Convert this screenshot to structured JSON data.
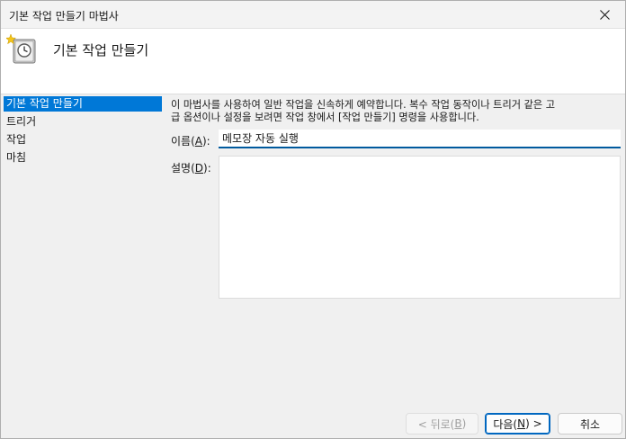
{
  "window": {
    "title": "기본 작업 만들기 마법사"
  },
  "header": {
    "title": "기본 작업 만들기",
    "icon": "task-scheduler-clock-icon"
  },
  "nav": {
    "items": [
      {
        "label": "기본 작업 만들기",
        "active": true
      },
      {
        "label": "트리거",
        "active": false
      },
      {
        "label": "작업",
        "active": false
      },
      {
        "label": "마침",
        "active": false
      }
    ]
  },
  "main": {
    "description_line1": "이 마법사를 사용하여 일반 작업을 신속하게 예약합니다. 복수 작업 동작이나 트리거 같은 고",
    "description_line2": "급 옵션이나 설정을 보려면 작업 창에서 [작업 만들기] 명령을 사용합니다.",
    "name_label": "이름",
    "name_accel": "A",
    "name_value": "메모장 자동 실행",
    "desc_label": "설명",
    "desc_accel": "D",
    "desc_value": ""
  },
  "buttons": {
    "back_prefix": "< 뒤로(",
    "back_accel": "B",
    "back_suffix": ")",
    "next_prefix": "다음(",
    "next_accel": "N",
    "next_suffix": ") >",
    "cancel": "취소"
  },
  "colors": {
    "accent": "#0078d7",
    "input_underline": "#005a9e"
  }
}
